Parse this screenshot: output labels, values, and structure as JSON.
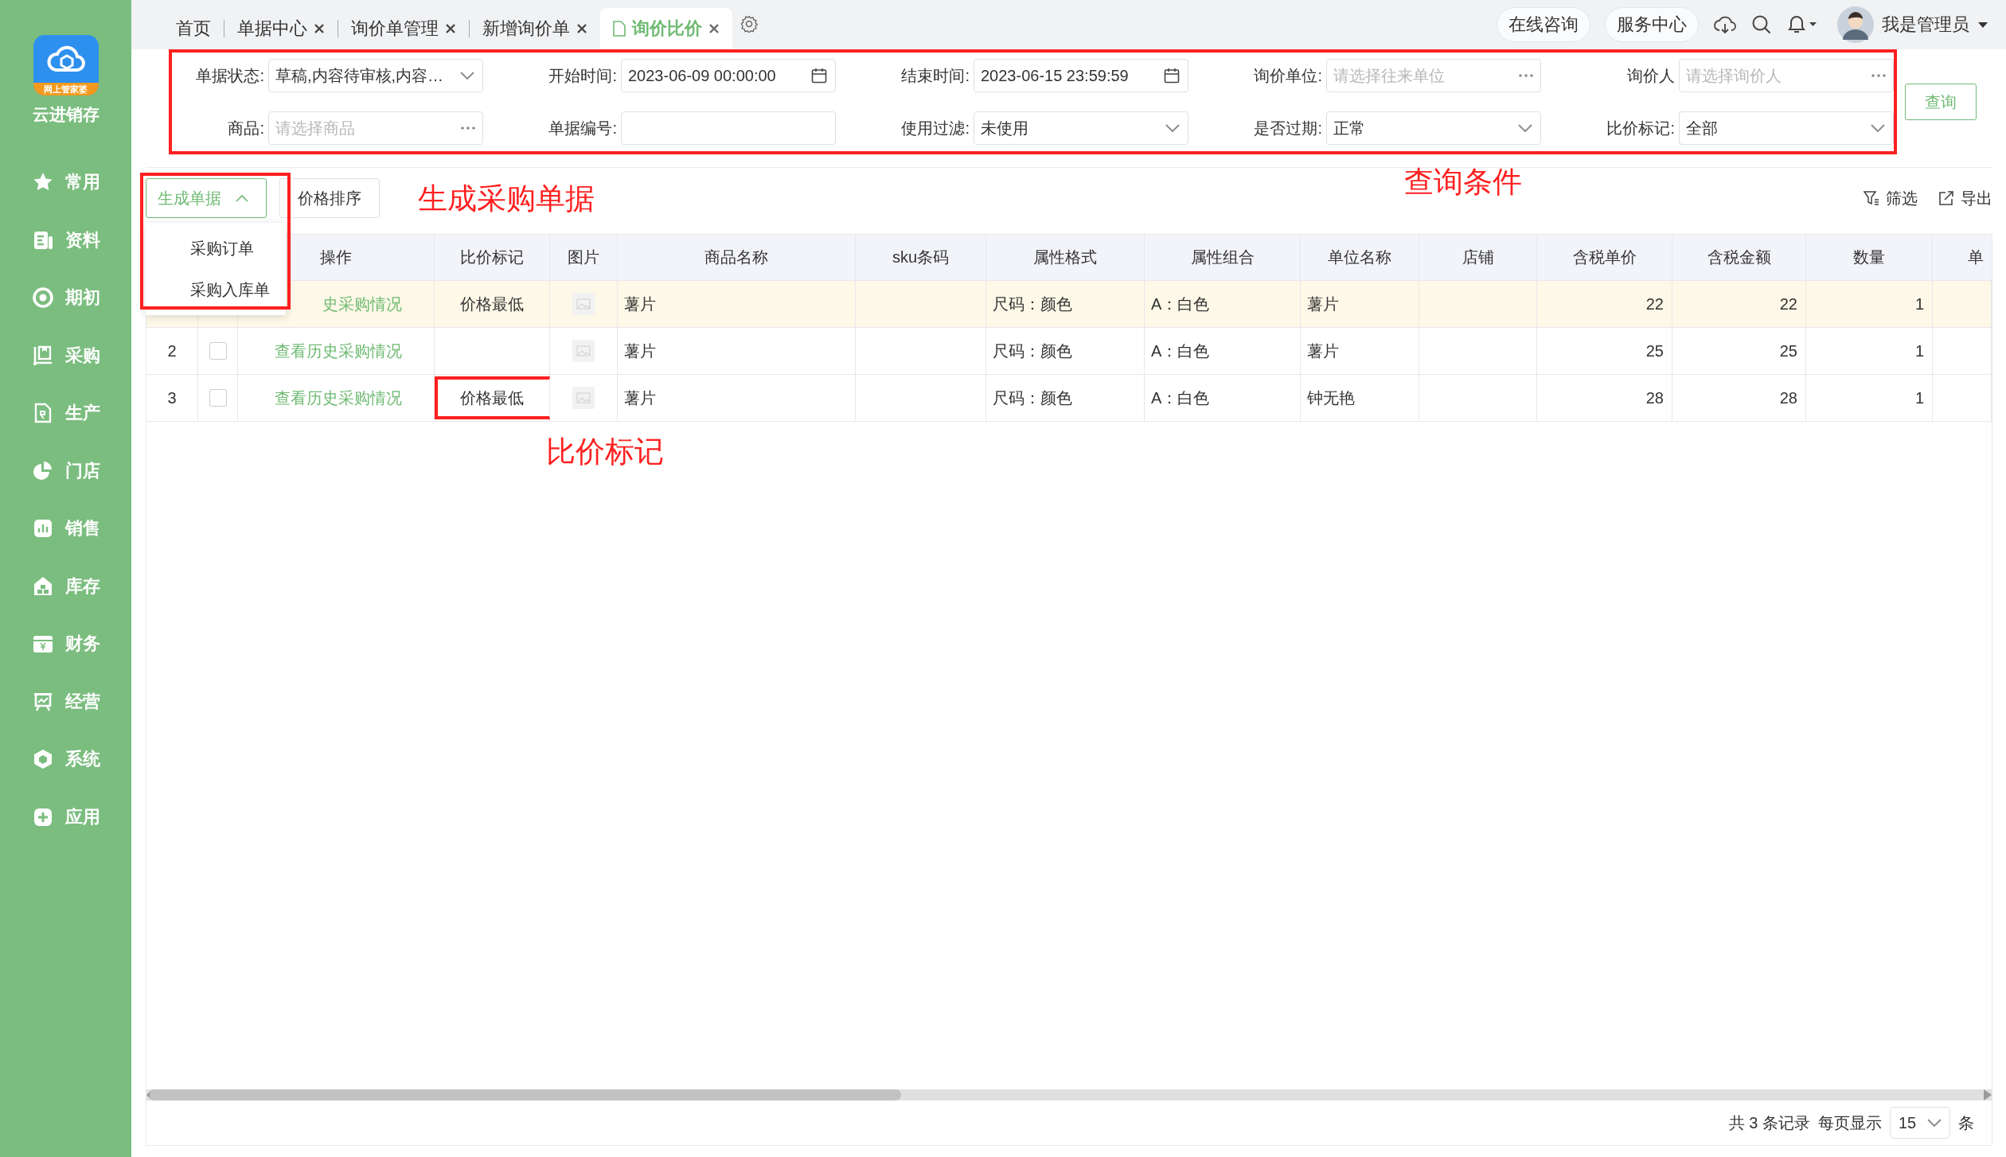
{
  "app": {
    "name": "云进销存",
    "logo_caption": "网上管家婆"
  },
  "sidebar": {
    "items": [
      {
        "label": "常用",
        "kind": "star"
      },
      {
        "label": "资料",
        "kind": "doc"
      },
      {
        "label": "期初",
        "kind": "target"
      },
      {
        "label": "采购",
        "kind": "cart"
      },
      {
        "label": "生产",
        "kind": "file"
      },
      {
        "label": "门店",
        "kind": "pie"
      },
      {
        "label": "销售",
        "kind": "bars"
      },
      {
        "label": "库存",
        "kind": "house"
      },
      {
        "label": "财务",
        "kind": "wallet"
      },
      {
        "label": "经营",
        "kind": "easel"
      },
      {
        "label": "系统",
        "kind": "hexagon"
      },
      {
        "label": "应用",
        "kind": "plus"
      }
    ]
  },
  "tabs": [
    {
      "label": "首页",
      "closable": false,
      "selected": false
    },
    {
      "label": "单据中心",
      "closable": true,
      "selected": false
    },
    {
      "label": "询价单管理",
      "closable": true,
      "selected": false
    },
    {
      "label": "新增询价单",
      "closable": true,
      "selected": false
    },
    {
      "label": "询价比价",
      "closable": true,
      "selected": true
    }
  ],
  "header": {
    "buttons": [
      "在线咨询",
      "服务中心"
    ],
    "user": "我是管理员"
  },
  "filters": {
    "outlined": true,
    "fields": [
      {
        "label": "单据状态:",
        "kind": "select",
        "value": "草稿,内容待审核,内容…"
      },
      {
        "label": "开始时间:",
        "kind": "date",
        "value": "2023-06-09 00:00:00"
      },
      {
        "label": "结束时间:",
        "kind": "date",
        "value": "2023-06-15 23:59:59"
      },
      {
        "label": "询价单位:",
        "kind": "picker",
        "placeholder": "请选择往来单位"
      },
      {
        "label": "询价人",
        "kind": "picker",
        "placeholder": "请选择询价人"
      },
      {
        "label": "商品:",
        "kind": "picker",
        "placeholder": "请选择商品"
      },
      {
        "label": "单据编号:",
        "kind": "text"
      },
      {
        "label": "使用过滤:",
        "kind": "select",
        "value": "未使用"
      },
      {
        "label": "是否过期:",
        "kind": "select",
        "value": "正常"
      },
      {
        "label": "比价标记:",
        "kind": "select",
        "value": "全部"
      }
    ],
    "query_button": "查询"
  },
  "toolbar": {
    "generate_button": {
      "label": "生成单据",
      "expanded": true,
      "outlined": true
    },
    "sort_button": "价格排序",
    "menu": [
      "采购订单",
      "采购入库单"
    ],
    "tools": [
      {
        "label": "筛选",
        "kind": "filter"
      },
      {
        "label": "导出",
        "kind": "export"
      }
    ]
  },
  "table": {
    "columns": [
      "操作",
      "比价标记",
      "图片",
      "商品名称",
      "sku条码",
      "属性格式",
      "属性组合",
      "单位名称",
      "店铺",
      "含税单价",
      "含税金额",
      "数量",
      "单"
    ],
    "rows": [
      {
        "selected": true,
        "outlined": false,
        "operation": "史采购情况",
        "mark": "价格最低",
        "product": "薯片",
        "attr_format": "尺码：颜色",
        "attr_combo": "A：白色",
        "unit": "薯片",
        "unit_price": "22",
        "amount": "22",
        "qty": "1"
      },
      {
        "selected": false,
        "outlined": false,
        "index": "2",
        "checked": false,
        "operation": "查看历史采购情况",
        "product": "薯片",
        "attr_format": "尺码：颜色",
        "attr_combo": "A：白色",
        "unit": "薯片",
        "unit_price": "25",
        "amount": "25",
        "qty": "1"
      },
      {
        "selected": false,
        "outlined": true,
        "index": "3",
        "checked": false,
        "operation": "查看历史采购情况",
        "mark": "价格最低",
        "product": "薯片",
        "attr_format": "尺码：颜色",
        "attr_combo": "A：白色",
        "unit": "钟无艳",
        "unit_price": "28",
        "amount": "28",
        "qty": "1"
      }
    ]
  },
  "pager": {
    "summary": "共 3 条记录",
    "per_page_label": "每页显示",
    "page_size": "15",
    "unit": "条"
  },
  "annotations": {
    "toolbar": "生成采购单据",
    "filters": "查询条件",
    "mark": "比价标记"
  }
}
